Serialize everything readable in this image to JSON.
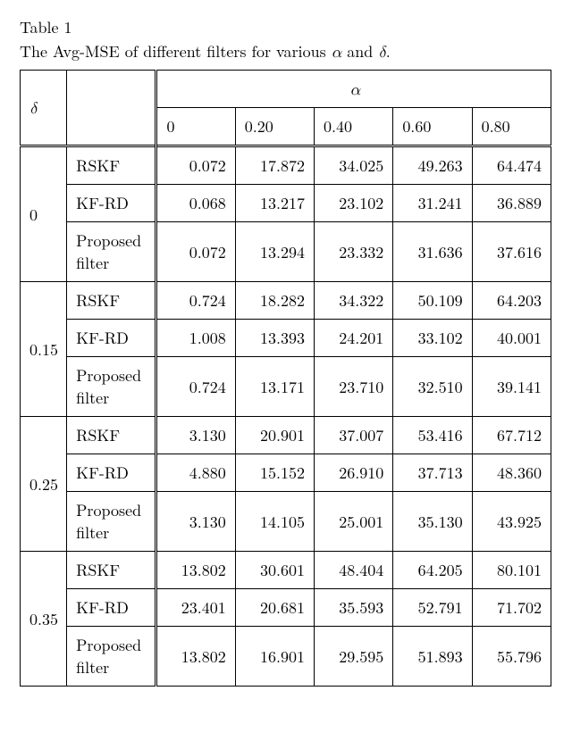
{
  "table_label": "Table 1",
  "caption_prefix": "The Avg-MSE of different filters for various ",
  "alpha_sym": "α",
  "caption_and": " and ",
  "delta_sym": "δ",
  "caption_end": ".",
  "header": {
    "delta": "δ",
    "alpha": "α",
    "alpha_cols": [
      "0",
      "0.20",
      "0.40",
      "0.60",
      "0.80"
    ]
  },
  "filters": [
    "RSKF",
    "KF-RD",
    "Proposed filter"
  ],
  "groups": [
    {
      "delta": "0",
      "rows": [
        [
          "0.072",
          "17.872",
          "34.025",
          "49.263",
          "64.474"
        ],
        [
          "0.068",
          "13.217",
          "23.102",
          "31.241",
          "36.889"
        ],
        [
          "0.072",
          "13.294",
          "23.332",
          "31.636",
          "37.616"
        ]
      ]
    },
    {
      "delta": "0.15",
      "rows": [
        [
          "0.724",
          "18.282",
          "34.322",
          "50.109",
          "64.203"
        ],
        [
          "1.008",
          "13.393",
          "24.201",
          "33.102",
          "40.001"
        ],
        [
          "0.724",
          "13.171",
          "23.710",
          "32.510",
          "39.141"
        ]
      ]
    },
    {
      "delta": "0.25",
      "rows": [
        [
          "3.130",
          "20.901",
          "37.007",
          "53.416",
          "67.712"
        ],
        [
          "4.880",
          "15.152",
          "26.910",
          "37.713",
          "48.360"
        ],
        [
          "3.130",
          "14.105",
          "25.001",
          "35.130",
          "43.925"
        ]
      ]
    },
    {
      "delta": "0.35",
      "rows": [
        [
          "13.802",
          "30.601",
          "48.404",
          "64.205",
          "80.101"
        ],
        [
          "23.401",
          "20.681",
          "35.593",
          "52.791",
          "71.702"
        ],
        [
          "13.802",
          "16.901",
          "29.595",
          "51.893",
          "55.796"
        ]
      ]
    }
  ],
  "chart_data": {
    "type": "table",
    "title": "The Avg-MSE of different filters for various α and δ.",
    "row_factor": "δ",
    "row_levels": [
      0,
      0.15,
      0.25,
      0.35
    ],
    "sub_factor": "filter",
    "sub_levels": [
      "RSKF",
      "KF-RD",
      "Proposed filter"
    ],
    "col_factor": "α",
    "col_levels": [
      0,
      0.2,
      0.4,
      0.6,
      0.8
    ],
    "values": [
      [
        [
          0.072,
          17.872,
          34.025,
          49.263,
          64.474
        ],
        [
          0.068,
          13.217,
          23.102,
          31.241,
          36.889
        ],
        [
          0.072,
          13.294,
          23.332,
          31.636,
          37.616
        ]
      ],
      [
        [
          0.724,
          18.282,
          34.322,
          50.109,
          64.203
        ],
        [
          1.008,
          13.393,
          24.201,
          33.102,
          40.001
        ],
        [
          0.724,
          13.171,
          23.71,
          32.51,
          39.141
        ]
      ],
      [
        [
          3.13,
          20.901,
          37.007,
          53.416,
          67.712
        ],
        [
          4.88,
          15.152,
          26.91,
          37.713,
          48.36
        ],
        [
          3.13,
          14.105,
          25.001,
          35.13,
          43.925
        ]
      ],
      [
        [
          13.802,
          30.601,
          48.404,
          64.205,
          80.101
        ],
        [
          23.401,
          20.681,
          35.593,
          52.791,
          71.702
        ],
        [
          13.802,
          16.901,
          29.595,
          51.893,
          55.796
        ]
      ]
    ]
  }
}
